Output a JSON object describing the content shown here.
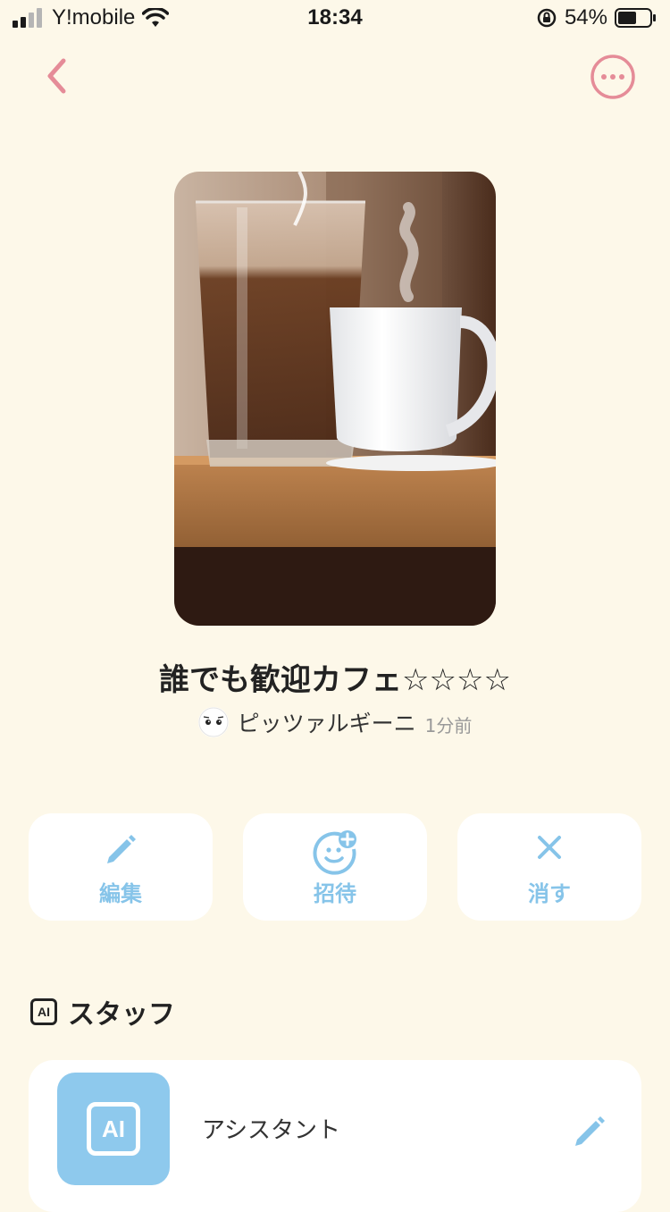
{
  "status_bar": {
    "carrier": "Y!mobile",
    "time": "18:34",
    "battery": "54%"
  },
  "room": {
    "title": "誰でも歓迎カフェ☆☆☆☆",
    "author": "ピッツァルギーニ",
    "time_ago": "1分前"
  },
  "actions": {
    "edit": "編集",
    "invite": "招待",
    "delete": "消す"
  },
  "staff": {
    "section_title": "スタッフ",
    "badge": "AI",
    "items": [
      {
        "name": "アシスタント",
        "avatar_label": "AI"
      }
    ]
  },
  "colors": {
    "background": "#fdf8e9",
    "accent_pink": "#e58c98",
    "accent_blue": "#86c4e9"
  }
}
